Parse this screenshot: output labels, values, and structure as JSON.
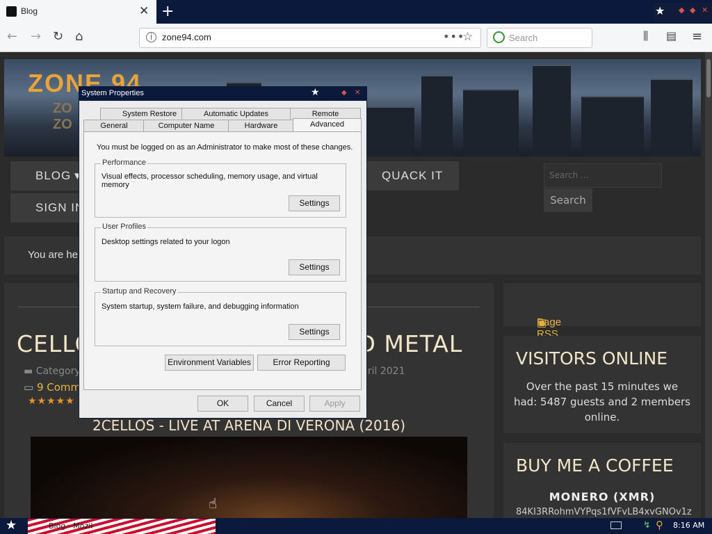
{
  "browser": {
    "tab_title": "Blog",
    "tab_close": "✕",
    "new_tab": "+",
    "url": "zone94.com",
    "page_actions": "•••",
    "search_placeholder": "Search"
  },
  "site": {
    "logo": "ZONE 94",
    "logo_sub1": "ZO",
    "logo_sub2": "ZO",
    "menu": {
      "blog": "BLOG",
      "sign_in": "SIGN IN",
      "quack_it": "QUACK IT",
      "blog_arrow": "▾"
    },
    "search_placeholder": "Search ...",
    "search_button": "Search",
    "breadcrumb": "You are he",
    "article": {
      "title_left": "CELLO",
      "title_right": "D METAL",
      "category": "Category",
      "date": "pril 2021",
      "comments": "9 Comm",
      "stars": "★★★★★",
      "video_title": "2CELLOS - LIVE AT ARENA DI VERONA (2016)"
    },
    "sidebar": {
      "rss": "Page RSS 2.0 Feed",
      "visitors_heading": "VISITORS ONLINE",
      "visitors_text": "Over the past 15 minutes we had: 5487 guests and 2 members online.",
      "coffee_heading": "BUY ME A COFFEE",
      "monero_label": "MONERO (XMR)",
      "monero_address": "84KI3RRohmVYPqs1fVFvLB4xvGNOv1z"
    }
  },
  "dialog": {
    "title": "System Properties",
    "tabs_row1": [
      "System Restore",
      "Automatic Updates",
      "Remote"
    ],
    "tabs_row2": [
      "General",
      "Computer Name",
      "Hardware",
      "Advanced"
    ],
    "admin_notice": "You must be logged on as an Administrator to make most of these changes.",
    "performance": {
      "label": "Performance",
      "text": "Visual effects, processor scheduling, memory usage, and virtual memory",
      "button": "Settings"
    },
    "user_profiles": {
      "label": "User Profiles",
      "text": "Desktop settings related to your logon",
      "button": "Settings"
    },
    "startup": {
      "label": "Startup and Recovery",
      "text": "System startup, system failure, and debugging information",
      "button": "Settings"
    },
    "env_button": "Environment Variables",
    "error_button": "Error Reporting",
    "ok": "OK",
    "cancel": "Cancel",
    "apply": "Apply"
  },
  "taskbar": {
    "task_label": "Blog - Mozil",
    "clock": "8:16 AM"
  },
  "colors": {
    "accent": "#e8b341",
    "title_bar": "#0b1a3c"
  }
}
